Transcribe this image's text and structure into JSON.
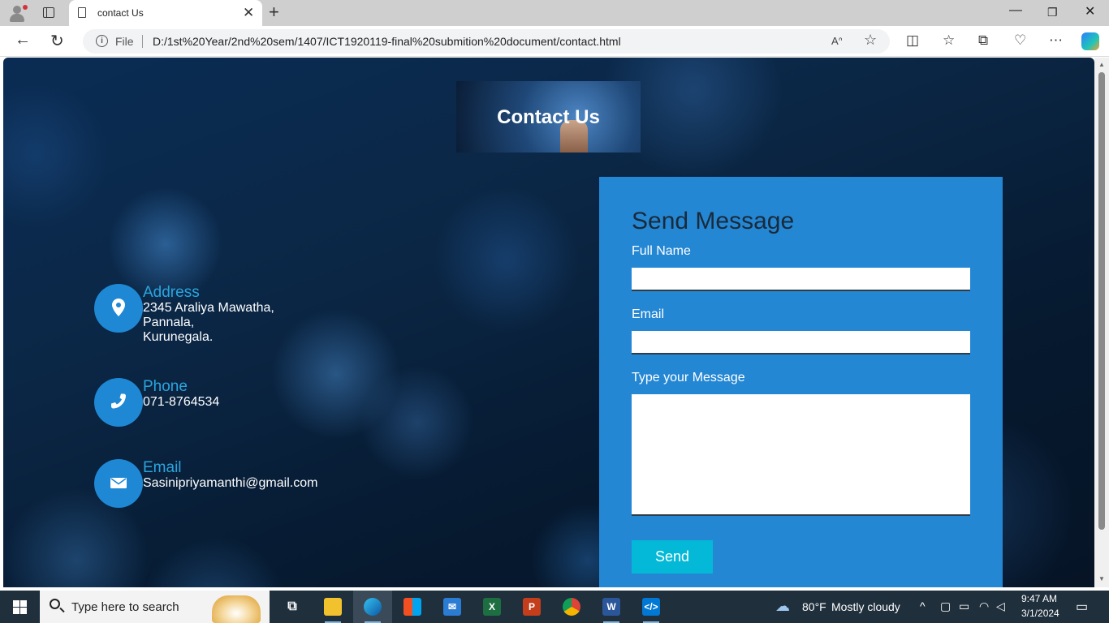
{
  "browser": {
    "tab_title": "contact Us",
    "url_scheme_label": "File",
    "url": "D:/1st%20Year/2nd%20sem/1407/ICT1920119-final%20submition%20document/contact.html"
  },
  "page": {
    "header_title": "Contact Us",
    "contact_info": {
      "address": {
        "title": "Address",
        "lines": [
          "2345 Araliya Mawatha,",
          "Pannala,",
          "Kurunegala."
        ]
      },
      "phone": {
        "title": "Phone",
        "value": "071-8764534"
      },
      "email": {
        "title": "Email",
        "value": "Sasinipriyamanthi@gmail.com"
      }
    },
    "form": {
      "title": "Send Message",
      "full_name_label": "Full Name",
      "full_name_value": "",
      "email_label": "Email",
      "email_value": "",
      "message_label": "Type your Message",
      "message_value": "",
      "send_label": "Send"
    }
  },
  "taskbar": {
    "search_placeholder": "Type here to search",
    "weather_temp": "80°F",
    "weather_desc": "Mostly cloudy",
    "time": "9:47 AM",
    "date": "3/1/2024",
    "apps": [
      "task-view",
      "file-explorer",
      "edge",
      "store",
      "mail",
      "excel",
      "powerpoint",
      "chrome",
      "word",
      "vscode"
    ]
  },
  "colors": {
    "panel_bg": "#2487d4",
    "accent_title": "#2aa5df",
    "send_button": "#04b9d7",
    "icon_circle": "#1e88d5"
  }
}
